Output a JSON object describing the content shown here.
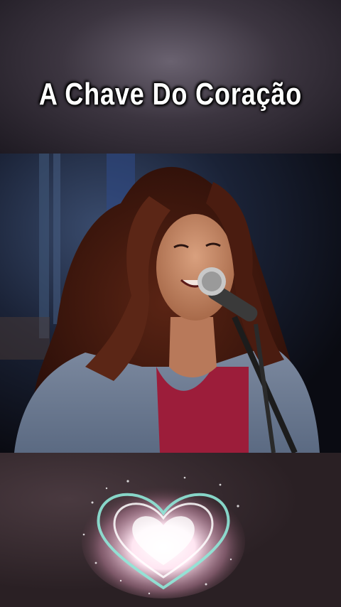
{
  "video": {
    "title": "A Chave Do  Coração"
  },
  "colors": {
    "title_text": "#ffffff",
    "heart_glow": "#ffe6f2",
    "heart_outline": "#8fe8d8"
  },
  "icons": {
    "decoration": "heart-icon",
    "microphone": "microphone-icon"
  }
}
